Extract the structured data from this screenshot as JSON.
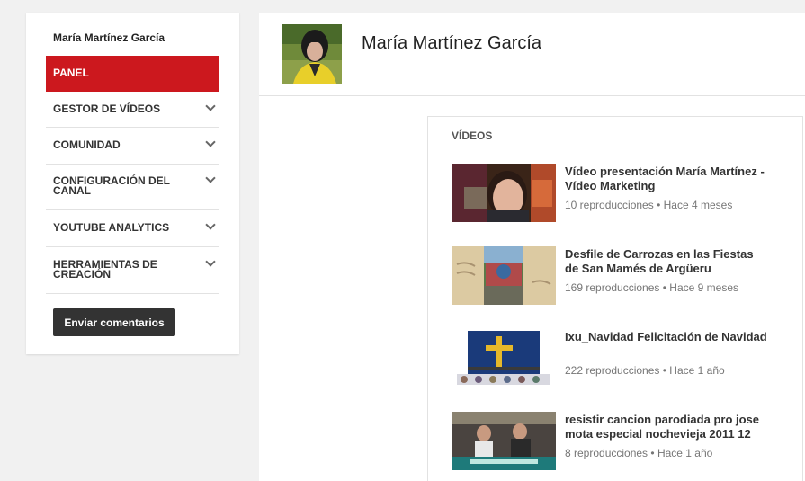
{
  "sidebar": {
    "user_name": "María Martínez García",
    "panel_label": "PANEL",
    "items": [
      {
        "label": "GESTOR DE VÍDEOS"
      },
      {
        "label": "COMUNIDAD"
      },
      {
        "label": "CONFIGURACIÓN DEL CANAL"
      },
      {
        "label": "YOUTUBE ANALYTICS"
      },
      {
        "label": "HERRAMIENTAS DE CREACIÓN"
      }
    ],
    "feedback_button": "Enviar comentarios"
  },
  "header": {
    "channel_name": "María Martínez García"
  },
  "videos": {
    "title": "VÍDEOS",
    "items": [
      {
        "title": "Vídeo presentación María Martínez - Vídeo Marketing",
        "views": "10 reproducciones",
        "age": "Hace 4 meses"
      },
      {
        "title": "Desfile de Carrozas en las Fiestas de San Mamés de Argüeru",
        "views": "169 reproducciones",
        "age": "Hace 9 meses"
      },
      {
        "title": "Ixu_Navidad Felicitación de Navidad",
        "views": "222 reproducciones",
        "age": "Hace 1 año"
      },
      {
        "title": "resistir cancion parodiada pro jose mota especial nochevieja 2011 12",
        "views": "8 reproducciones",
        "age": "Hace 1 año"
      }
    ]
  },
  "colors": {
    "accent": "#cc181e",
    "button_dark": "#333333"
  }
}
